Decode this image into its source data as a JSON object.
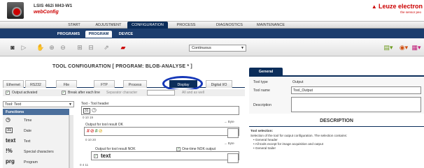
{
  "header": {
    "device": "LSIS 462i M43-W1",
    "app_name": "webConfig",
    "brand": "Leuze electron",
    "slogan": "the sensor peo"
  },
  "main_nav": [
    "START",
    "ADJUSTMENT",
    "CONFIGURATION",
    "PROCESS",
    "DIAGNOSTICS",
    "MAINTENANCE"
  ],
  "main_nav_active": "CONFIGURATION",
  "sub_nav": [
    "PROGRAMS",
    "PROGRAM",
    "DEVICE"
  ],
  "sub_nav_active": "PROGRAM",
  "toolbar": {
    "mode": "Continuous"
  },
  "tool_config": {
    "title": "TOOL CONFIGURATION   [ PROGRAM: BLOB-ANALYSE * ]",
    "tabs": [
      "Ethernet",
      "RS232",
      "File",
      "FTP",
      "Process",
      "Display",
      "Digital I/O"
    ],
    "active_tab": "Display",
    "output_activated": "Output activated",
    "break_after_each_line": "Break after each line",
    "separator_label": "Separator character",
    "all_as_well": "All and as well"
  },
  "tool_list": {
    "selected": "Tool: Text",
    "functions_header": "Functions",
    "items": [
      {
        "icon": "clock-icon",
        "symbol": "◷",
        "label": "Time"
      },
      {
        "icon": "calendar-icon",
        "symbol": "31",
        "label": "Date"
      },
      {
        "icon": "text-icon",
        "symbol": "text",
        "label": "Text"
      },
      {
        "icon": "percent-icon",
        "symbol": "!%",
        "label": "Special characters"
      },
      {
        "icon": "program-icon",
        "symbol": "prg",
        "label": "Program"
      }
    ]
  },
  "config": {
    "header_label": "Text - Tool header",
    "ruler1": "0    10    19",
    "byte1": "→ Byte",
    "ok_label": "Output for tool result OK",
    "ruler2": "0    10    20",
    "byte2": "→ Byte",
    "nok_label": "Output for tool result NOK",
    "one_time_nok": "One-time NOK output",
    "nok_text": "text",
    "ruler3": "0  4       11"
  },
  "right_panel": {
    "tab": "General",
    "tool_type_label": "Tool type",
    "tool_type_value": "Output",
    "tool_name_label": "Tool name",
    "tool_name_value": "Tool_Output",
    "description_label": "Description"
  },
  "description": {
    "title": "DESCRIPTION",
    "heading": "Tool selection:",
    "text": "Selection of the tool for output configuration. The selection contains:",
    "bullets": [
      "• General header",
      "• All tools except for image acquisition and output",
      "• General trailer"
    ]
  },
  "colors": {
    "brand_red": "#cc0000",
    "nav_blue": "#0b2d5a",
    "highlight": "#1638b8"
  }
}
